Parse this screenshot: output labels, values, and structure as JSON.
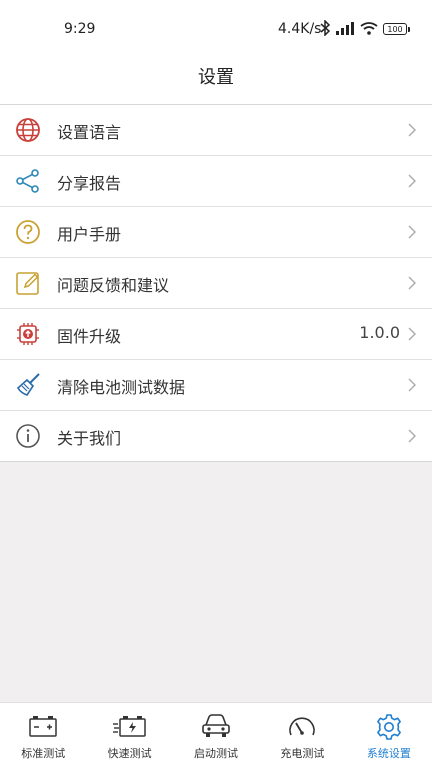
{
  "status": {
    "time": "9:29",
    "network_speed": "4.4K/s",
    "battery": "100"
  },
  "header": {
    "title": "设置"
  },
  "settings": [
    {
      "label": "设置语言",
      "icon": "globe-icon",
      "value": ""
    },
    {
      "label": "分享报告",
      "icon": "share-icon",
      "value": ""
    },
    {
      "label": "用户手册",
      "icon": "help-icon",
      "value": ""
    },
    {
      "label": "问题反馈和建议",
      "icon": "feedback-edit-icon",
      "value": ""
    },
    {
      "label": "固件升级",
      "icon": "firmware-upgrade-icon",
      "value": "1.0.0"
    },
    {
      "label": "清除电池测试数据",
      "icon": "broom-icon",
      "value": ""
    },
    {
      "label": "关于我们",
      "icon": "info-icon",
      "value": ""
    }
  ],
  "tabs": [
    {
      "label": "标准测试",
      "icon": "battery-standard-icon"
    },
    {
      "label": "快速测试",
      "icon": "battery-quick-icon"
    },
    {
      "label": "启动测试",
      "icon": "car-icon"
    },
    {
      "label": "充电测试",
      "icon": "gauge-icon"
    },
    {
      "label": "系统设置",
      "icon": "gear-icon",
      "active": true
    }
  ],
  "colors": {
    "accent": "#1f7fd1",
    "icon_red": "#c9403a",
    "icon_gold": "#c9a233",
    "icon_blue": "#2a6aa8"
  }
}
